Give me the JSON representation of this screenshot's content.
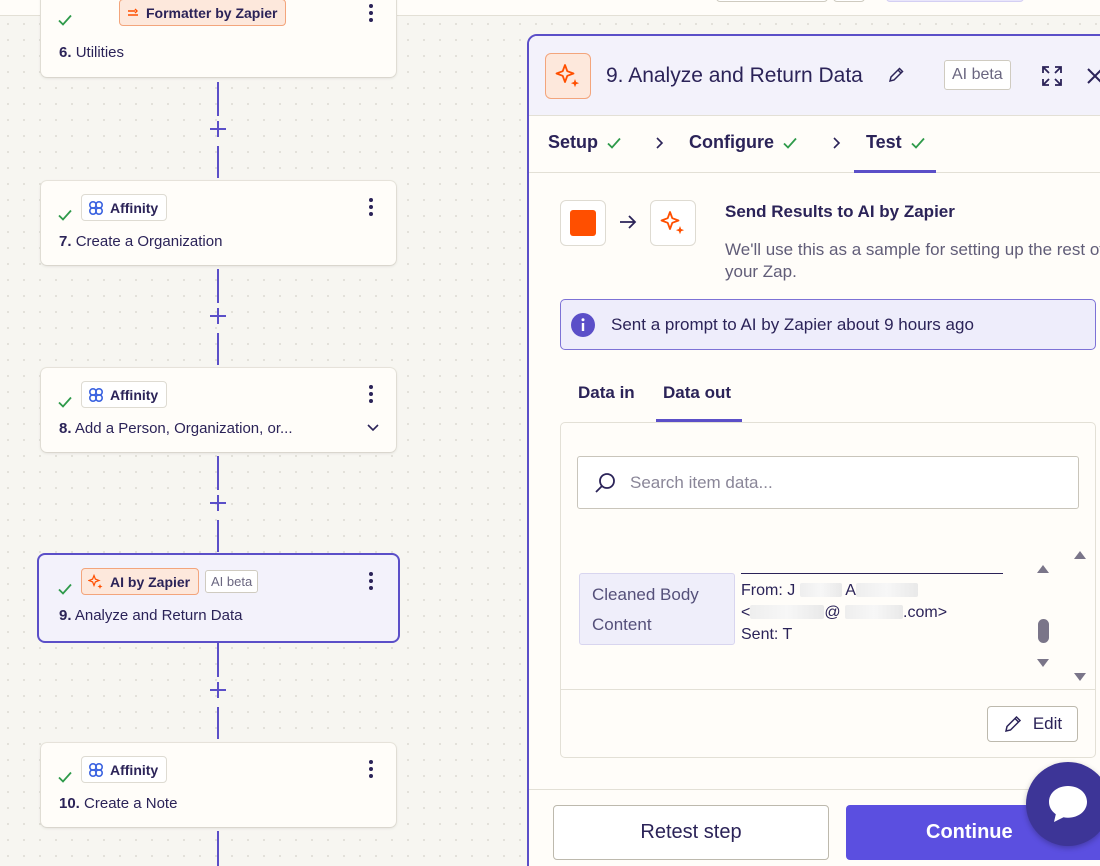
{
  "canvas": {
    "steps": [
      {
        "app": "Formatter by Zapier",
        "number": "6.",
        "title": "Utilities"
      },
      {
        "app": "Affinity",
        "number": "7.",
        "title": "Create a Organization"
      },
      {
        "app": "Affinity",
        "number": "8.",
        "title": "Add a Person, Organization, or..."
      },
      {
        "app": "AI by Zapier",
        "badge": "AI beta",
        "number": "9.",
        "title": "Analyze and Return Data"
      },
      {
        "app": "Affinity",
        "number": "10.",
        "title": "Create a Note"
      }
    ]
  },
  "panel": {
    "title": "9. Analyze and Return Data",
    "badge": "AI beta",
    "tabs": [
      "Setup",
      "Configure",
      "Test"
    ],
    "active_tab": "Test",
    "send": {
      "title": "Send Results to AI by Zapier",
      "description": "We'll use this as a sample for setting up the rest of your Zap."
    },
    "info": "Sent a prompt to AI by Zapier about 9 hours ago",
    "data_tabs": [
      "Data in",
      "Data out"
    ],
    "active_data_tab": "Data out",
    "search_placeholder": "Search item data...",
    "field": {
      "label_line1": "Cleaned Body",
      "label_line2": "Content",
      "from_prefix": "From: J",
      "from_mid": "A",
      "email_open": "<",
      "email_at": "@",
      "email_close": ".com>",
      "sent": "Sent: T"
    },
    "edit_label": "Edit",
    "retest_label": "Retest step",
    "continue_label": "Continue"
  },
  "colors": {
    "accent": "#5b4fc8",
    "zapier_orange": "#ff4f00",
    "success_green": "#2e9a4a"
  },
  "icons": [
    "check-icon",
    "formatter-icon",
    "affinity-icon",
    "ai-sparkle-icon",
    "more-vertical-icon",
    "chevron-down-icon",
    "plus-icon",
    "pencil-icon",
    "expand-icon",
    "close-icon",
    "chevron-right-icon",
    "arrow-right-icon",
    "info-icon",
    "search-icon",
    "chat-icon"
  ]
}
